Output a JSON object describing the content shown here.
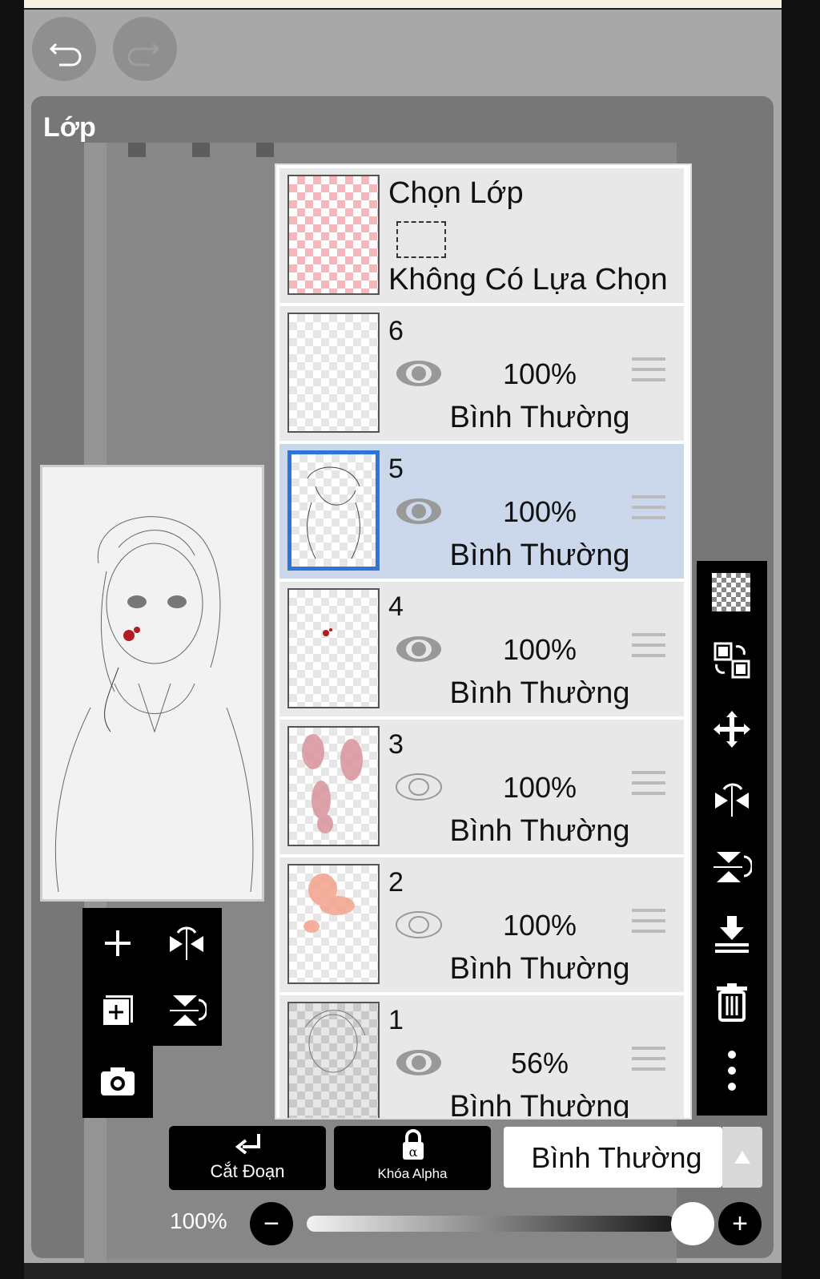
{
  "app": {
    "panel_title": "Lớp"
  },
  "selection": {
    "title": "Chọn Lớp",
    "status": "Không Có Lựa Chọn"
  },
  "layers": [
    {
      "name": "6",
      "opacity": "100%",
      "blend": "Bình Thường",
      "visible": true,
      "selected": false
    },
    {
      "name": "5",
      "opacity": "100%",
      "blend": "Bình Thường",
      "visible": true,
      "selected": true
    },
    {
      "name": "4",
      "opacity": "100%",
      "blend": "Bình Thường",
      "visible": true,
      "selected": false
    },
    {
      "name": "3",
      "opacity": "100%",
      "blend": "Bình Thường",
      "visible": false,
      "selected": false
    },
    {
      "name": "2",
      "opacity": "100%",
      "blend": "Bình Thường",
      "visible": false,
      "selected": false
    },
    {
      "name": "1",
      "opacity": "56%",
      "blend": "Bình Thường",
      "visible": true,
      "selected": false
    }
  ],
  "bottom": {
    "clip_label": "Cắt Đoạn",
    "alpha_lock_label": "Khóa Alpha",
    "blend_mode": "Bình Thường",
    "opacity_value": "100%",
    "opacity_fraction": 1.0
  },
  "colors": {
    "selected_row": "#cbd8ec",
    "selected_border": "#2f74d8",
    "panel": "#777777"
  },
  "icons": [
    "undo-icon",
    "redo-icon",
    "add-layer-icon",
    "flip-horizontal-icon",
    "duplicate-layer-icon",
    "flip-vertical-icon",
    "camera-icon",
    "transparency-icon",
    "swap-layers-icon",
    "move-icon",
    "merge-down-icon",
    "delete-icon",
    "more-icon"
  ]
}
